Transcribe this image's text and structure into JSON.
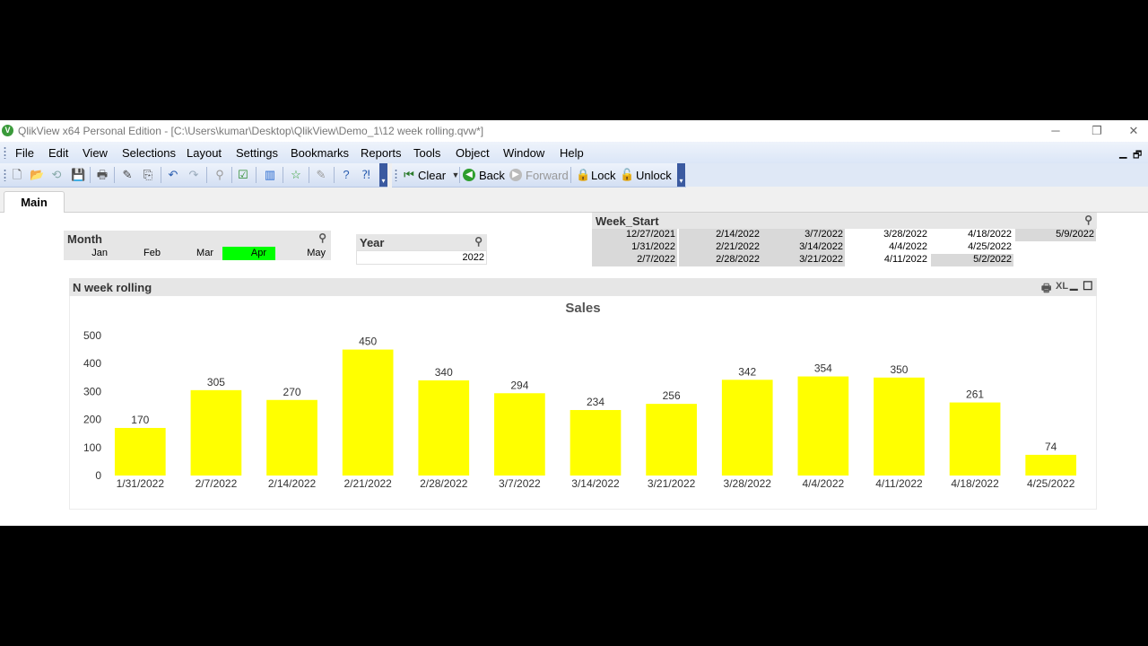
{
  "window": {
    "logo_letter": "V",
    "title": "QlikView x64 Personal Edition - [C:\\Users\\kumar\\Desktop\\QlikView\\Demo_1\\12 week rolling.qvw*]",
    "minimize_glyph": "─",
    "restore_glyph": "❐",
    "close_glyph": "✕"
  },
  "menu": {
    "items": [
      "File",
      "Edit",
      "View",
      "Selections",
      "Layout",
      "Settings",
      "Bookmarks",
      "Reports",
      "Tools",
      "Object",
      "Window",
      "Help"
    ],
    "mdi_minimize": "▁",
    "mdi_restore": "🗗"
  },
  "toolbar": {
    "icons": [
      "new-document-icon",
      "open-folder-icon",
      "reload-icon",
      "save-icon",
      "print-icon",
      "edit-script-icon",
      "reload-data-icon",
      "undo-icon",
      "redo-icon",
      "search-icon",
      "selections-icon",
      "chart-wizard-icon",
      "bookmark-star-icon",
      "edit-module-icon",
      "help-icon",
      "context-help-icon"
    ],
    "clear_label": "Clear",
    "back_label": "Back",
    "forward_label": "Forward",
    "lock_label": "Lock",
    "unlock_label": "Unlock"
  },
  "tabs": {
    "main_label": "Main"
  },
  "month_listbox": {
    "title": "Month",
    "items": [
      {
        "label": "Jan",
        "selected": false
      },
      {
        "label": "Feb",
        "selected": false
      },
      {
        "label": "Mar",
        "selected": false
      },
      {
        "label": "Apr",
        "selected": true
      },
      {
        "label": "May",
        "selected": false
      }
    ]
  },
  "year_listbox": {
    "title": "Year",
    "value": "2022"
  },
  "week_start_listbox": {
    "title": "Week_Start",
    "columns": [
      [
        {
          "label": "12/27/2021",
          "state": "excluded"
        },
        {
          "label": "1/31/2022",
          "state": "excluded"
        },
        {
          "label": "2/7/2022",
          "state": "excluded"
        }
      ],
      [
        {
          "label": "2/14/2022",
          "state": "excluded"
        },
        {
          "label": "2/21/2022",
          "state": "excluded"
        },
        {
          "label": "2/28/2022",
          "state": "excluded"
        }
      ],
      [
        {
          "label": "3/7/2022",
          "state": "excluded"
        },
        {
          "label": "3/14/2022",
          "state": "excluded"
        },
        {
          "label": "3/21/2022",
          "state": "excluded"
        }
      ],
      [
        {
          "label": "3/28/2022",
          "state": "possible"
        },
        {
          "label": "4/4/2022",
          "state": "possible"
        },
        {
          "label": "4/11/2022",
          "state": "possible"
        }
      ],
      [
        {
          "label": "4/18/2022",
          "state": "possible"
        },
        {
          "label": "4/25/2022",
          "state": "possible"
        },
        {
          "label": "5/2/2022",
          "state": "excluded"
        }
      ],
      [
        {
          "label": "5/9/2022",
          "state": "excluded"
        }
      ]
    ]
  },
  "chart_object": {
    "title": "N week rolling",
    "print_icon_glyph": "🖶",
    "xl_label": "XL",
    "minimize_glyph": "▁",
    "maximize_glyph": "☐"
  },
  "chart_data": {
    "type": "bar",
    "title": "Sales",
    "xlabel": "",
    "ylabel": "",
    "categories": [
      "1/31/2022",
      "2/7/2022",
      "2/14/2022",
      "2/21/2022",
      "2/28/2022",
      "3/7/2022",
      "3/14/2022",
      "3/21/2022",
      "3/28/2022",
      "4/4/2022",
      "4/11/2022",
      "4/18/2022",
      "4/25/2022"
    ],
    "values": [
      170,
      305,
      270,
      450,
      340,
      294,
      234,
      256,
      342,
      354,
      350,
      261,
      74
    ],
    "ylim": [
      0,
      500
    ],
    "yticks": [
      0,
      100,
      200,
      300,
      400,
      500
    ],
    "grid": false,
    "legend": "none",
    "bar_color": "#ffff00"
  },
  "colors": {
    "selected": "#00ff00",
    "excluded": "#d9d9d9",
    "possible": "#ffffff",
    "caption_bg": "#e6e6e6"
  }
}
